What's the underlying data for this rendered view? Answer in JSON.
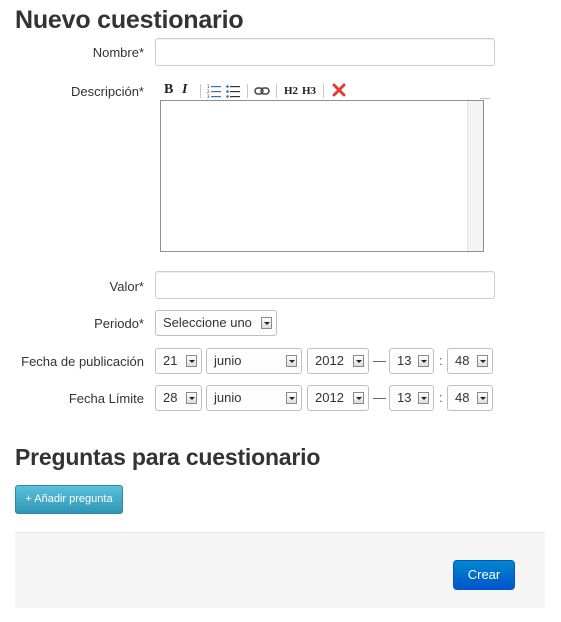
{
  "form": {
    "title": "Nuevo cuestionario",
    "nombre_label": "Nombre*",
    "descripcion_label": "Descripción*",
    "valor_label": "Valor*",
    "periodo_label": "Periodo*",
    "periodo_value": "Seleccione uno",
    "pub_label": "Fecha de publicación",
    "pub": {
      "day": "21",
      "month": "junio",
      "year": "2012",
      "dash": "—",
      "hour": "13",
      "colon": ":",
      "minute": "48"
    },
    "limit_label": "Fecha Límite",
    "limit": {
      "day": "28",
      "month": "junio",
      "year": "2012",
      "dash": "—",
      "hour": "13",
      "colon": ":",
      "minute": "48"
    }
  },
  "toolbar": {
    "bold": "B",
    "italic": "I",
    "h2": "H2",
    "h3": "H3",
    "icons": [
      "bold-icon",
      "italic-icon",
      "ordered-list-icon",
      "unordered-list-icon",
      "link-icon",
      "h2-icon",
      "h3-icon",
      "remove-format-icon"
    ]
  },
  "questions": {
    "title": "Preguntas para cuestionario",
    "add_button": "+ Añadir pregunta"
  },
  "actions": {
    "create_button": "Crear"
  },
  "colors": {
    "info_button": "#49afcd",
    "primary_button": "#0074cc",
    "remove_icon": "#e53935"
  }
}
